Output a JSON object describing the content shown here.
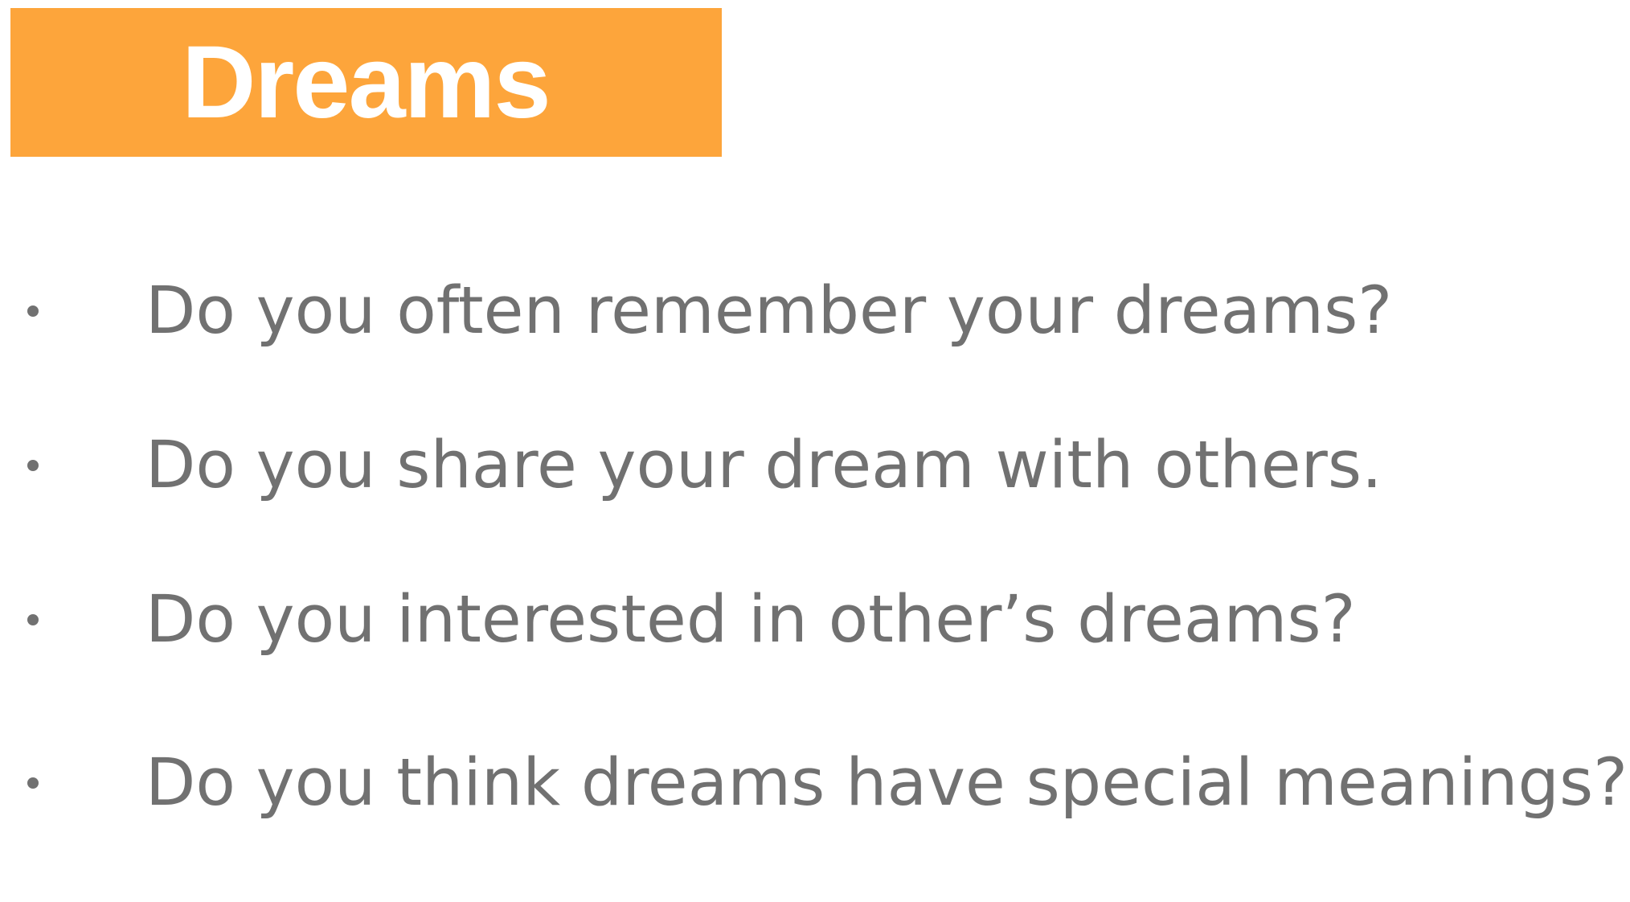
{
  "title": "Dreams",
  "colors": {
    "title_background": "#fda53b",
    "title_text": "#ffffff",
    "body_text": "#717171"
  },
  "bullets": [
    "Do you often remember your dreams?",
    "Do you share your dream with others.",
    "Do you interested in other’s dreams?",
    "Do you think dreams have special meanings?"
  ]
}
